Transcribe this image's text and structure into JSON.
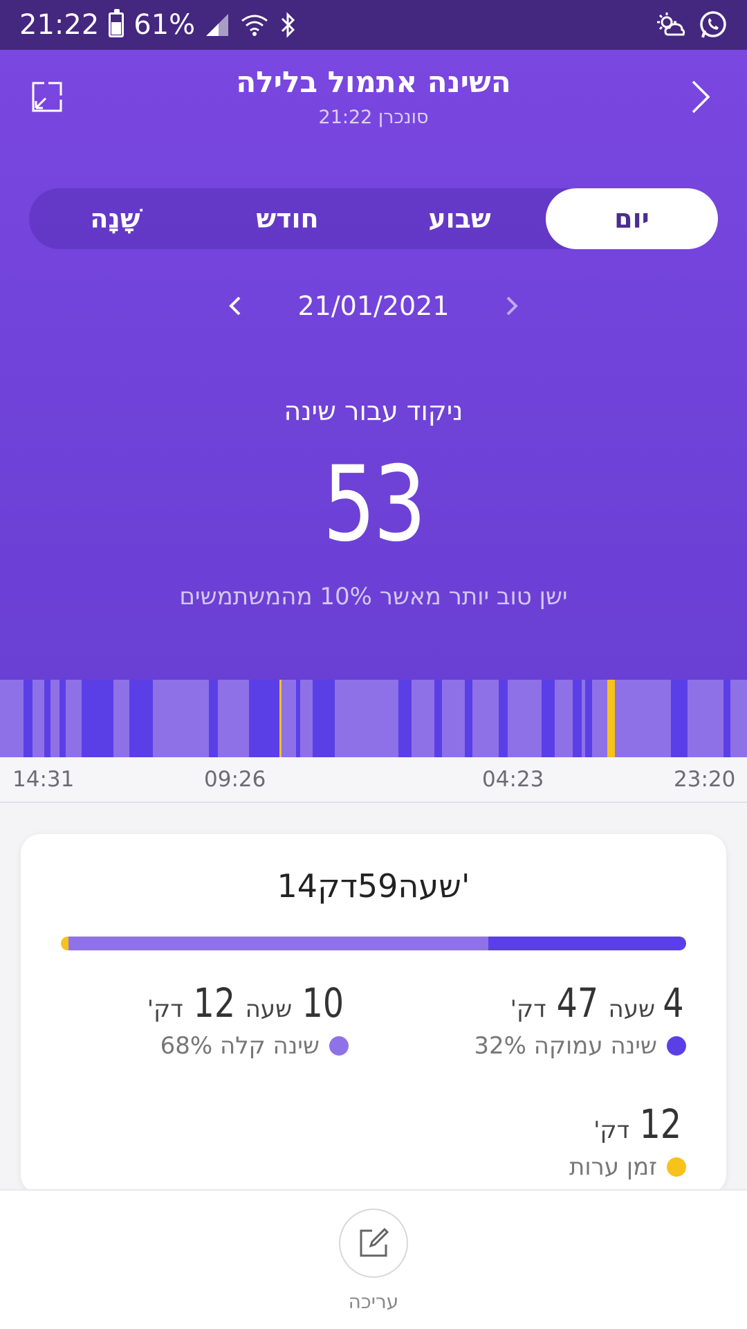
{
  "status_bar": {
    "time": "21:22",
    "battery": "61%",
    "icons": [
      "battery-icon",
      "signal-icon",
      "wifi-icon",
      "bluetooth-icon",
      "weather-icon",
      "whatsapp-icon"
    ]
  },
  "header": {
    "title": "השינה אתמול בלילה",
    "subtitle": "21:22 סונכרן"
  },
  "tabs": [
    {
      "label": "יום",
      "active": true
    },
    {
      "label": "שבוע",
      "active": false
    },
    {
      "label": "חודש",
      "active": false
    },
    {
      "label": "שָׁנָה",
      "active": false
    }
  ],
  "date": "21/01/2021",
  "score": {
    "label": "ניקוד עבור שינה",
    "value": "53",
    "comparison": "ישן טוב יותר מאשר 10% מהמשתמשים"
  },
  "timeline": {
    "labels": [
      "14:31",
      "09:26",
      "04:23",
      "23:20"
    ]
  },
  "summary": {
    "total": "14שעה59דק'",
    "deep": {
      "hours": "4",
      "hours_unit": "שעה",
      "minutes": "47",
      "minutes_unit": "דק'",
      "label": "שינה עמוקה 32%",
      "percent": 32
    },
    "light": {
      "hours": "10",
      "hours_unit": "שעה",
      "minutes": "12",
      "minutes_unit": "דק'",
      "label": "שינה קלה 68%",
      "percent": 68
    },
    "awake": {
      "minutes": "12",
      "minutes_unit": "דק'",
      "label": "זמן ערות"
    }
  },
  "bottom": {
    "edit_label": "עריכה"
  },
  "colors": {
    "deep": "#5b3fe6",
    "light": "#9072e8",
    "awake": "#f7c21a",
    "header": "#7644dc",
    "status_bar": "#44277f"
  }
}
